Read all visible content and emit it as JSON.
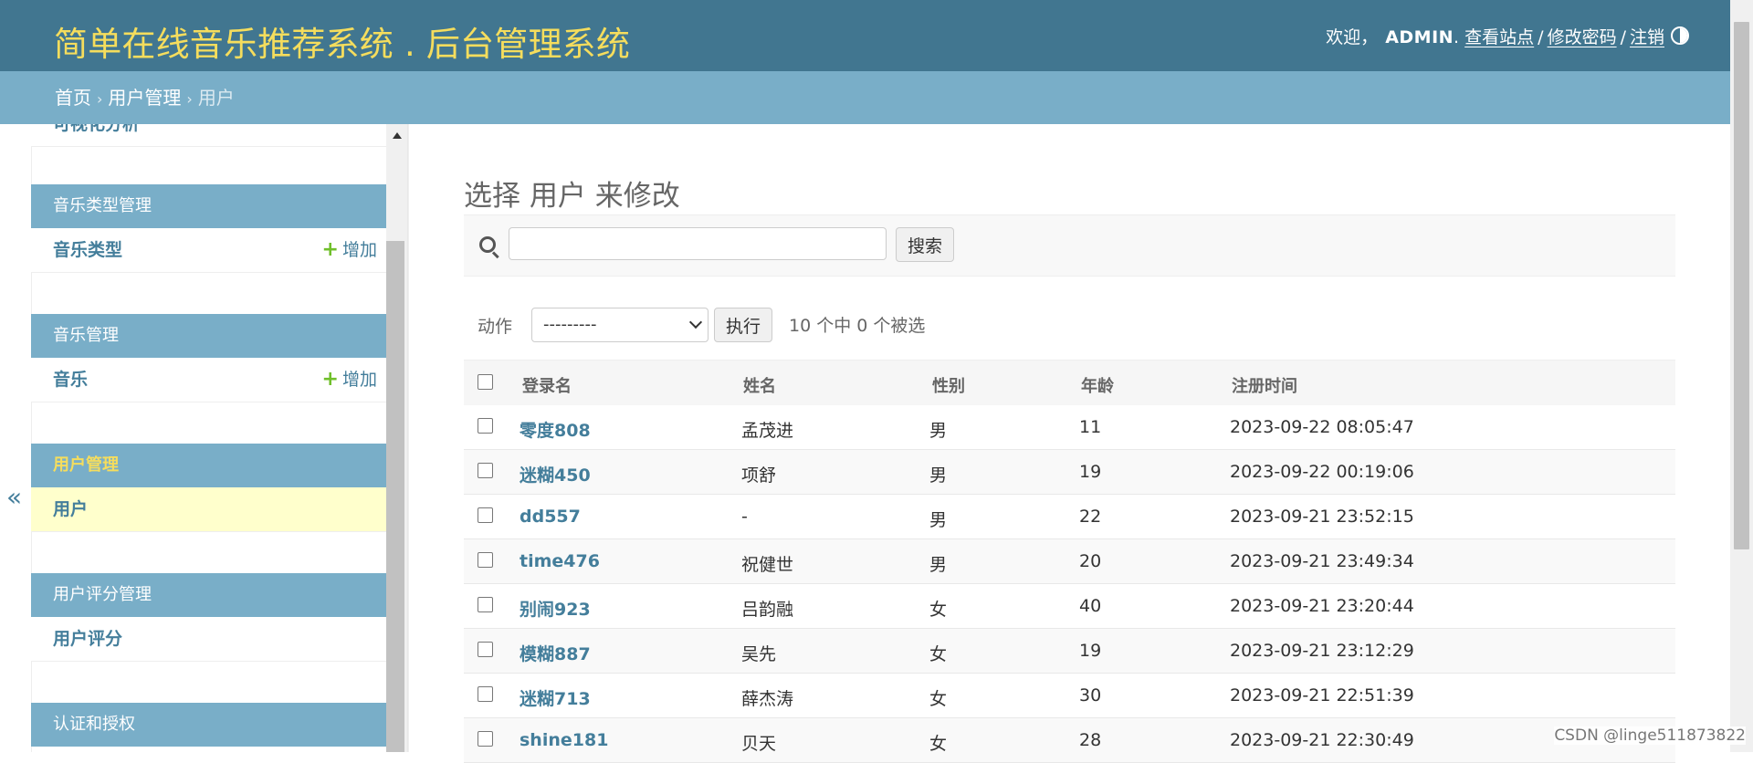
{
  "header": {
    "site_name": "简单在线音乐推荐系统 . 后台管理系统",
    "welcome": "欢迎，",
    "username": "ADMIN",
    "view_site": "查看站点",
    "sep": "/",
    "change_password": "修改密码",
    "logout": "注销",
    "theme_icon": "contrast-icon"
  },
  "breadcrumbs": {
    "home": "首页",
    "section": "用户管理",
    "current": "用户",
    "separator": "›"
  },
  "sidebar": {
    "collapse_glyph": "«",
    "clipped_label": "可视化分析",
    "modules": [
      {
        "caption": "音乐类型管理",
        "model": "音乐类型",
        "add": "增加"
      },
      {
        "caption": "音乐管理",
        "model": "音乐",
        "add": "增加"
      },
      {
        "caption": "用户管理",
        "model": "用户",
        "active": true
      },
      {
        "caption": "用户评分管理",
        "model": "用户评分"
      },
      {
        "caption": "认证和授权"
      }
    ]
  },
  "content": {
    "title": "选择 用户 来修改",
    "search": {
      "value": "",
      "button": "搜索"
    },
    "actions": {
      "label": "动作",
      "selected": "---------",
      "go": "执行",
      "counter": "10 个中 0 个被选"
    },
    "columns": [
      "登录名",
      "姓名",
      "性别",
      "年龄",
      "注册时间"
    ],
    "rows": [
      [
        "零度808",
        "孟茂进",
        "男",
        "11",
        "2023-09-22 08:05:47"
      ],
      [
        "迷糊450",
        "项舒",
        "男",
        "19",
        "2023-09-22 00:19:06"
      ],
      [
        "dd557",
        "-",
        "男",
        "22",
        "2023-09-21 23:52:15"
      ],
      [
        "time476",
        "祝健世",
        "男",
        "20",
        "2023-09-21 23:49:34"
      ],
      [
        "别闹923",
        "吕韵融",
        "女",
        "40",
        "2023-09-21 23:20:44"
      ],
      [
        "模糊887",
        "吴先",
        "女",
        "19",
        "2023-09-21 23:12:29"
      ],
      [
        "迷糊713",
        "薛杰涛",
        "女",
        "30",
        "2023-09-21 22:51:39"
      ],
      [
        "shine181",
        "贝天",
        "女",
        "28",
        "2023-09-21 22:30:49"
      ]
    ]
  },
  "watermark": "CSDN @linge511873822",
  "colors": {
    "header_bg": "#417690",
    "breadcrumb_bg": "#79aec8",
    "site_name": "#f5dd5d",
    "link": "#447e9b",
    "current_row": "#ffffcc",
    "add_plus": "#70bf2b"
  }
}
